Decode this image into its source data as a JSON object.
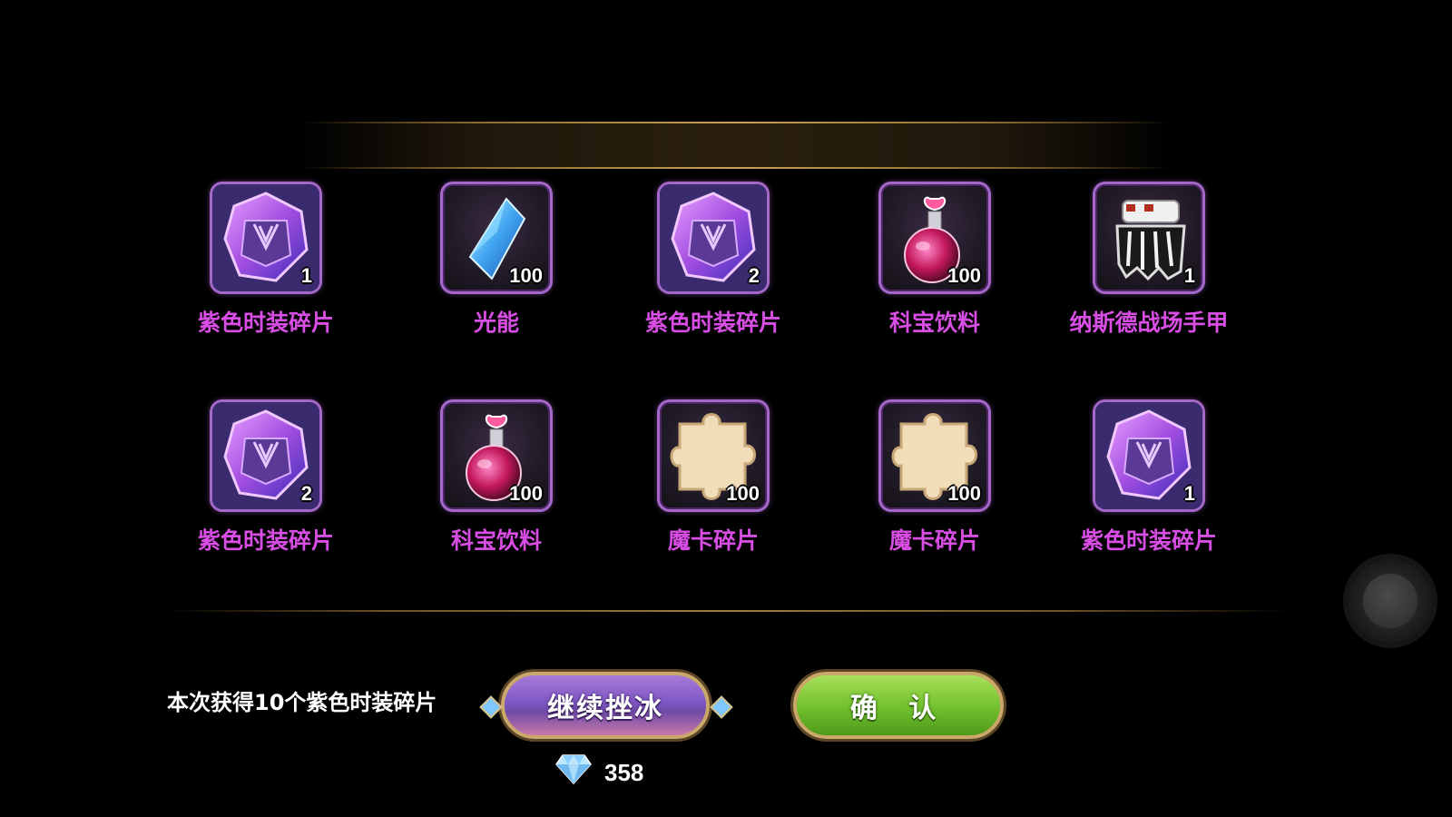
{
  "rewards": [
    {
      "name": "紫色时装碎片",
      "count": "1",
      "icon": "purple-fashion-shard-icon"
    },
    {
      "name": "光能",
      "count": "100",
      "icon": "light-energy-crystal-icon"
    },
    {
      "name": "紫色时装碎片",
      "count": "2",
      "icon": "purple-fashion-shard-icon"
    },
    {
      "name": "科宝饮料",
      "count": "100",
      "icon": "potion-icon"
    },
    {
      "name": "纳斯德战场手甲",
      "count": "1",
      "icon": "gauntlet-icon"
    },
    {
      "name": "紫色时装碎片",
      "count": "2",
      "icon": "purple-fashion-shard-icon"
    },
    {
      "name": "科宝饮料",
      "count": "100",
      "icon": "potion-icon"
    },
    {
      "name": "魔卡碎片",
      "count": "100",
      "icon": "puzzle-piece-icon"
    },
    {
      "name": "魔卡碎片",
      "count": "100",
      "icon": "puzzle-piece-icon"
    },
    {
      "name": "紫色时装碎片",
      "count": "1",
      "icon": "purple-fashion-shard-icon"
    }
  ],
  "summary_text": "本次获得10个紫色时装碎片",
  "buttons": {
    "continue_label": "继续挫冰",
    "confirm_label": "确 认"
  },
  "cost": {
    "amount": "358",
    "icon": "diamond-icon"
  },
  "colors": {
    "item_name": "#d84de4",
    "slot_border": "#a468c8",
    "continue_button": "#7e57c4",
    "confirm_button": "#74c32f"
  }
}
